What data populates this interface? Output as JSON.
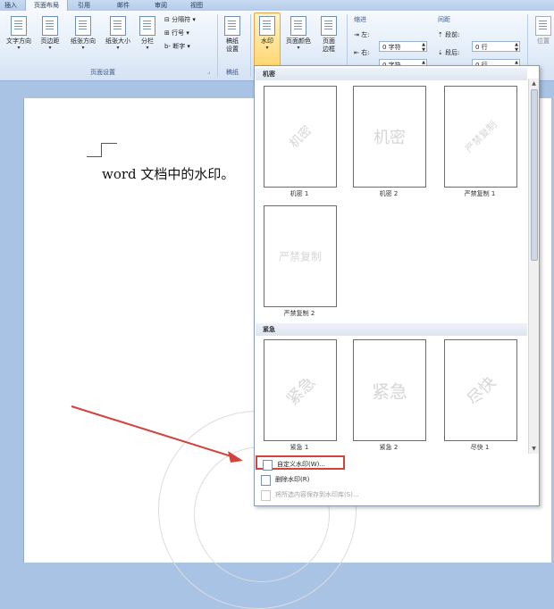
{
  "tabs": [
    {
      "label": "插入"
    },
    {
      "label": "页面布局",
      "active": true
    },
    {
      "label": "引用"
    },
    {
      "label": "邮件"
    },
    {
      "label": "审阅"
    },
    {
      "label": "视图"
    }
  ],
  "ribbon": {
    "page_setup": {
      "text_direction": "文字方向",
      "margins": "页边距",
      "orientation": "纸张方向",
      "size": "纸张大小",
      "columns": "分栏",
      "breaks": "分隔符",
      "line_numbers": "行号",
      "hyphenation": "断字",
      "group_label": "页面设置"
    },
    "draft": {
      "label": "稿纸\n设置",
      "group_label": "稿纸"
    },
    "background": {
      "watermark": "水印",
      "page_color": "页面颜色",
      "page_borders": "页面\n边框"
    },
    "indent": {
      "title": "缩进",
      "left_label": "左:",
      "left_value": "0 字符",
      "right_label": "右:",
      "right_value": "0 字符"
    },
    "spacing": {
      "title": "间距",
      "before_label": "段前:",
      "before_value": "0 行",
      "after_label": "段后:",
      "after_value": "0 行"
    },
    "position": "位置"
  },
  "document": {
    "body_text": "word 文档中的水印。"
  },
  "watermark_gallery": {
    "sections": [
      {
        "header": "机密",
        "items": [
          {
            "caption": "机密 1",
            "wm": "机密",
            "style": "diagonal"
          },
          {
            "caption": "机密 2",
            "wm": "机密",
            "style": "horizontal"
          },
          {
            "caption": "严禁复制 1",
            "wm": "严禁复制",
            "style": "diagonal"
          },
          {
            "caption": "严禁复制 2",
            "wm": "严禁复制",
            "style": "horizontal"
          }
        ]
      },
      {
        "header": "紧急",
        "items": [
          {
            "caption": "紧急 1",
            "wm": "紧急",
            "style": "diagonal"
          },
          {
            "caption": "紧急 2",
            "wm": "紧急",
            "style": "horizontal"
          },
          {
            "caption": "尽快 1",
            "wm": "尽快",
            "style": "diagonal"
          }
        ]
      }
    ],
    "menu": {
      "custom": "自定义水印(W)...",
      "remove": "删除水印(R)",
      "save": "将所选内容保存到水印库(S)..."
    }
  },
  "colors": {
    "accent_highlight": "#ffd66f",
    "annotation_red": "#d3423b"
  }
}
